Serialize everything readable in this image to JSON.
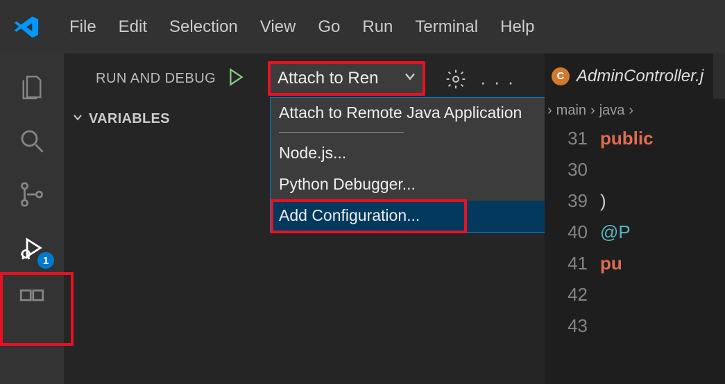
{
  "menu": {
    "items": [
      "File",
      "Edit",
      "Selection",
      "View",
      "Go",
      "Run",
      "Terminal",
      "Help"
    ]
  },
  "activity": {
    "run_badge": "1"
  },
  "run_panel": {
    "label": "RUN AND DEBUG",
    "section_variables": "VARIABLES"
  },
  "config": {
    "selected": "Attach to Ren"
  },
  "dropdown": {
    "item_attach": "Attach to Remote Java Application",
    "item_node": "Node.js...",
    "item_python": "Python Debugger...",
    "item_add": "Add Configuration..."
  },
  "editor": {
    "tab_title": "AdminController.j",
    "lang_badge": "C",
    "crumb1": "main",
    "crumb2": "java",
    "lines": {
      "n1": "31",
      "t1": "public",
      "n2": "30",
      "t2": "",
      "n3": "39",
      "t3": ")",
      "n4": "40",
      "t4a": "@",
      "t4b": "P",
      "n5": "41",
      "t5": "pu",
      "n6": "42",
      "t6": "",
      "n7": "43",
      "t7": ""
    }
  }
}
